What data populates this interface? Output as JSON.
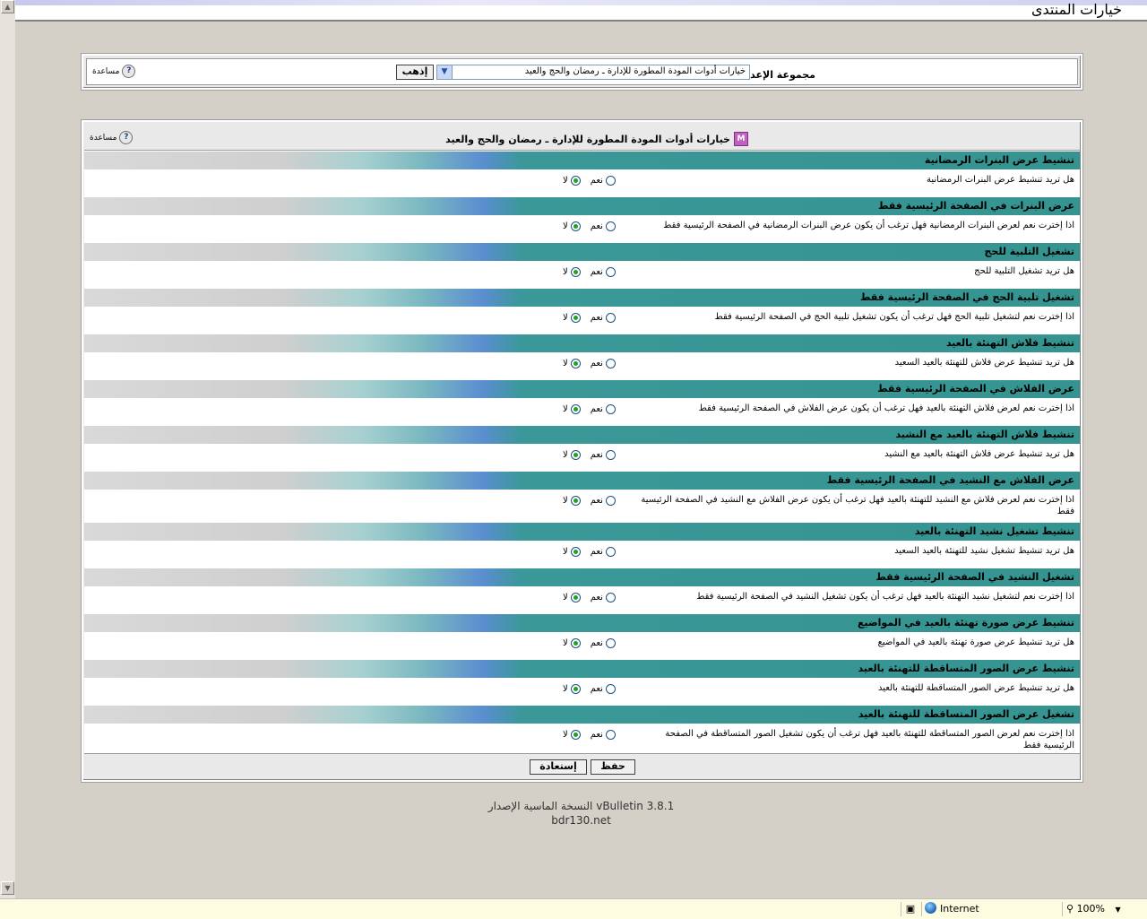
{
  "page": {
    "title": "خيارات المنتدى"
  },
  "help_label": "مساعدة",
  "group_select": {
    "label": "مجموعة الإعداد",
    "selected": "خيارات أدوات المودة المطورة للإدارة ـ رمضان والحج والعيد",
    "go_button": "إذهب"
  },
  "settings_panel": {
    "title": "خيارات أدوات المودة المطورة للإدارة ـ رمضان والحج والعيد",
    "yes_label": "نعم",
    "no_label": "لا",
    "save_button": "حفظ",
    "reset_button": "إستعادة",
    "sections": [
      {
        "title": "تنشيط عرض البنرات الرمضانية",
        "desc": "هل تريد تنشيط عرض البنرات الرمضانية",
        "value": "no"
      },
      {
        "title": "عرض البنرات في الصفحة الرئيسية فقط",
        "desc": "اذا إخترت نعم لعرض البنرات الرمضانية فهل ترغب أن يكون عرض البنرات الرمضانية في الصفحة الرئيسية فقط",
        "value": "no"
      },
      {
        "title": "تشغيل التلبية للحج",
        "desc": "هل تريد تشغيل التلبية للحج",
        "value": "no"
      },
      {
        "title": "تشغيل تلبية الحج في الصفحة الرئيسية فقط",
        "desc": "اذا إخترت نعم لتشغيل تلبية الحج فهل ترغب أن يكون تشغيل تلبية الحج في الصفحة الرئيسية فقط",
        "value": "no"
      },
      {
        "title": "تنشيط فلاش التهنئة بالعيد",
        "desc": "هل تريد تنشيط عرض فلاش للتهنئة بالعيد السعيد",
        "value": "no"
      },
      {
        "title": "عرض الفلاش في الصفحة الرئيسية فقط",
        "desc": "اذا إخترت نعم لعرض فلاش التهنئة بالعيد فهل ترغب أن يكون عرض الفلاش في الصفحة الرئيسية فقط",
        "value": "no"
      },
      {
        "title": "تنشيط فلاش التهنئة بالعيد مع النشيد",
        "desc": "هل تريد تنشيط عرض فلاش التهنئة بالعيد مع النشيد",
        "value": "no"
      },
      {
        "title": "عرض الفلاش مع النشيد في الصفحة الرئيسية فقط",
        "desc": "اذا إخترت نعم لعرض فلاش مع النشيد للتهنئة بالعيد فهل ترغب أن يكون عرض الفلاش مع النشيد في الصفحة الرئيسية فقط",
        "value": "no"
      },
      {
        "title": "تنشيط تشغيل نشيد التهنئة بالعيد",
        "desc": "هل تريد تنشيط تشغيل نشيد للتهنئة بالعيد السعيد",
        "value": "no"
      },
      {
        "title": "تشغيل النشيد في الصفحة الرئيسية فقط",
        "desc": "اذا إخترت نعم لتشغيل نشيد التهنئة بالعيد فهل ترغب أن يكون تشغيل النشيد في الصفحة الرئيسية فقط",
        "value": "no"
      },
      {
        "title": "تنشيط عرض صورة تهنئة بالعيد في المواضيع",
        "desc": "هل تريد تنشيط عرض صورة تهنئة بالعيد في المواضيع",
        "value": "no"
      },
      {
        "title": "تنشيط عرض الصور المتساقطة للتهنئة بالعيد",
        "desc": "هل تريد تنشيط عرض الصور المتساقطة للتهنئة بالعيد",
        "value": "no"
      },
      {
        "title": "تشغيل عرض الصور المتساقطة للتهنئة بالعيد",
        "desc": "اذا إخترت نعم لعرض الصور المتساقطة للتهنئة بالعيد فهل ترغب أن يكون تشغيل الصور المتساقطة في الصفحة الرئيسية فقط",
        "value": "no"
      }
    ]
  },
  "copyright": {
    "line1": "النسخة الماسية الإصدار vBulletin 3.8.1",
    "line2": "bdr130.net"
  },
  "statusbar": {
    "zone": "Internet",
    "zoom": "100%"
  }
}
